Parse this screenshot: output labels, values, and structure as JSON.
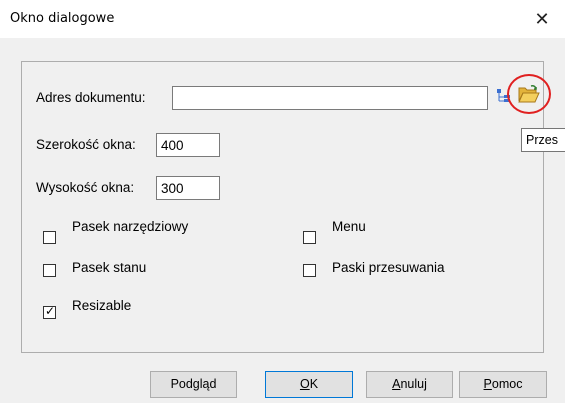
{
  "window": {
    "title": "Okno dialogowe",
    "close_glyph": "✕"
  },
  "form": {
    "address_label": "Adres dokumentu:",
    "address_value": "",
    "width_label": "Szerokość okna:",
    "width_value": "400",
    "height_label": "Wysokość okna:",
    "height_value": "300"
  },
  "checkboxes": {
    "toolbar": {
      "label": "Pasek narzędziowy",
      "checked": false
    },
    "menu": {
      "label": "Menu",
      "checked": false
    },
    "status": {
      "label": "Pasek stanu",
      "checked": false
    },
    "scrollbars": {
      "label": "Paski przesuwania",
      "checked": false
    },
    "resizable": {
      "label": "Resizable",
      "checked": true,
      "mark": "✓"
    }
  },
  "tooltip": {
    "text": "Przes"
  },
  "icons": {
    "tree": "tree-view-icon",
    "folder": "open-folder-icon"
  },
  "colors": {
    "highlight_circle": "#e02020",
    "default_button_border": "#0078d7"
  },
  "buttons": {
    "preview": {
      "label": "Podgląd"
    },
    "ok": {
      "underline": "O",
      "rest": "K"
    },
    "cancel": {
      "underline": "A",
      "rest": "nuluj"
    },
    "help": {
      "underline": "P",
      "rest": "omoc"
    }
  }
}
